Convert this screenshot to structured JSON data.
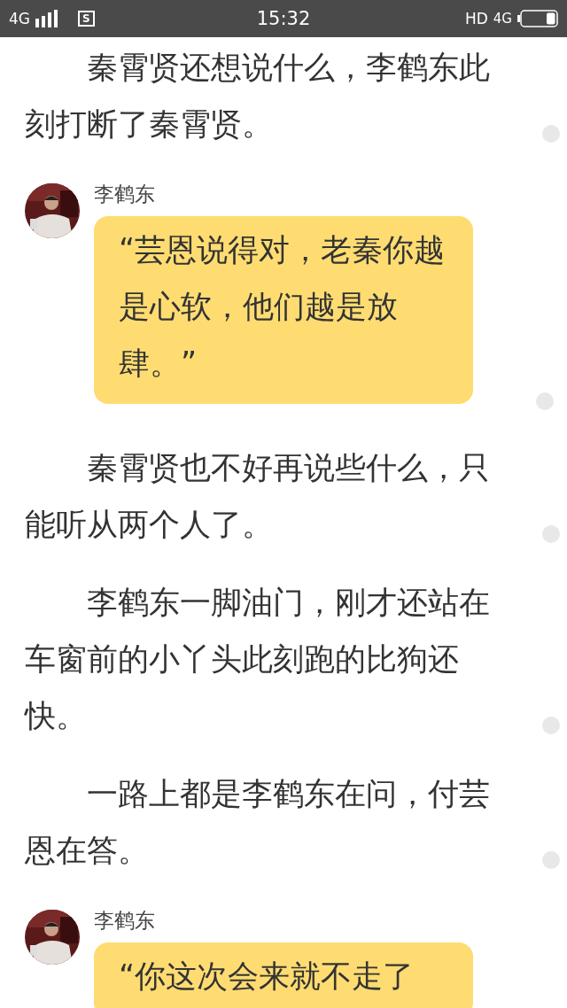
{
  "status_bar": {
    "network_left": "4G",
    "sim_badge": "S",
    "time": "15:32",
    "hd": "HD",
    "network_right": "4G"
  },
  "blocks": [
    {
      "kind": "paragraph",
      "text": "秦霄贤还想说什么，李鹤东此刻打断了秦霄贤。",
      "comment_marker": true
    },
    {
      "kind": "message",
      "speaker": "李鹤东",
      "text": "“芸恩说得对，老秦你越是心软，他们越是放肆。”",
      "comment_marker": true
    },
    {
      "kind": "paragraph",
      "text": "秦霄贤也不好再说些什么，只能听从两个人了。",
      "comment_marker": true
    },
    {
      "kind": "paragraph",
      "text": "李鹤东一脚油门，刚才还站在车窗前的小丫头此刻跑的比狗还快。",
      "comment_marker": true
    },
    {
      "kind": "paragraph",
      "text": "一路上都是李鹤东在问，付芸恩在答。",
      "comment_marker": true
    },
    {
      "kind": "message",
      "speaker": "李鹤东",
      "text": "“你这次会来就不走了",
      "comment_marker": false
    }
  ]
}
